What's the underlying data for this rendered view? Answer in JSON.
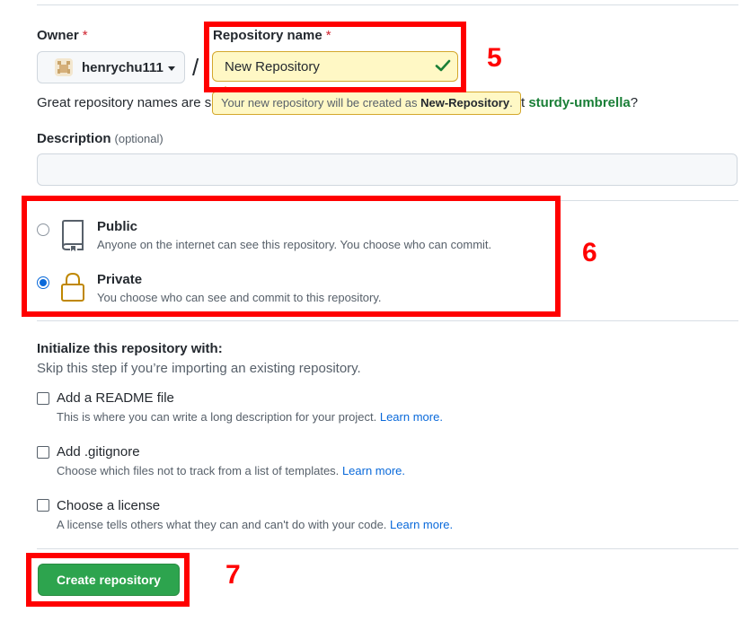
{
  "owner": {
    "label": "Owner",
    "required_mark": "*",
    "username": "henrychu111"
  },
  "repo_name": {
    "label": "Repository name",
    "required_mark": "*",
    "value": "New Repository",
    "separator": "/"
  },
  "tooltip": {
    "prefix": "Your new repository will be created as ",
    "name": "New-Repository",
    "suffix": "."
  },
  "hint": {
    "visible_start": "Great repository names are s",
    "visible_end": "t ",
    "suggestion": "sturdy-umbrella",
    "question_mark": "?"
  },
  "description": {
    "label": "Description",
    "optional": "(optional)",
    "value": ""
  },
  "visibility": {
    "options": [
      {
        "title": "Public",
        "desc": "Anyone on the internet can see this repository. You choose who can commit.",
        "checked": false
      },
      {
        "title": "Private",
        "desc": "You choose who can see and commit to this repository.",
        "checked": true
      }
    ]
  },
  "initialize": {
    "title": "Initialize this repository with:",
    "subtitle": "Skip this step if you’re importing an existing repository.",
    "options": [
      {
        "title": "Add a README file",
        "desc": "This is where you can write a long description for your project.",
        "link": "Learn more.",
        "checked": false
      },
      {
        "title": "Add .gitignore",
        "desc": "Choose which files not to track from a list of templates.",
        "link": "Learn more.",
        "checked": false
      },
      {
        "title": "Choose a license",
        "desc": "A license tells others what they can and can't do with your code.",
        "link": "Learn more.",
        "checked": false
      }
    ]
  },
  "create_button": "Create repository",
  "annotations": {
    "step5": "5",
    "step6": "6",
    "step7": "7"
  },
  "colors": {
    "annotation_red": "#ff0000",
    "create_green": "#2da44e",
    "link_blue": "#0969da",
    "suggestion_green": "#1a7f37",
    "tooltip_yellow": "#fff8c5"
  }
}
